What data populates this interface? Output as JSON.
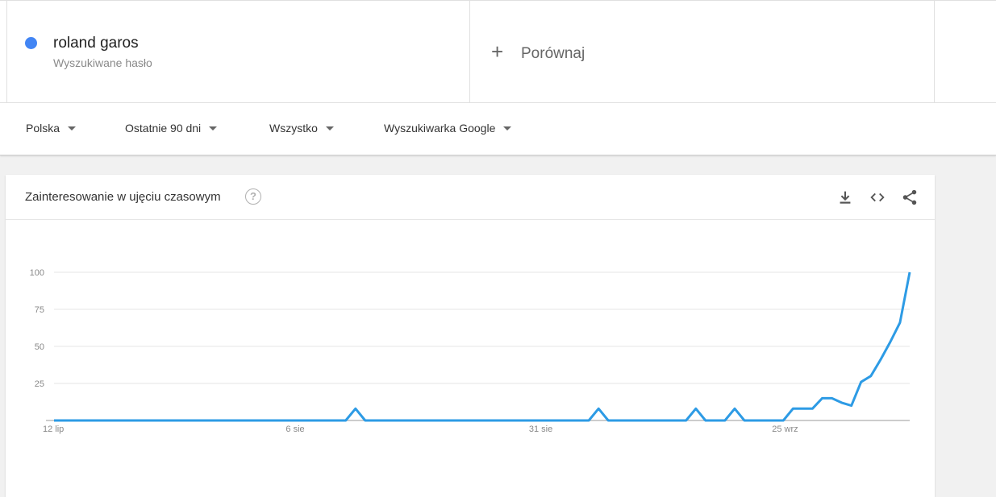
{
  "term": {
    "name": "roland garos",
    "subtitle": "Wyszukiwane hasło",
    "color": "#4285f4"
  },
  "compare": {
    "label": "Porównaj",
    "icon": "plus-icon"
  },
  "filters": [
    {
      "label": "Polska"
    },
    {
      "label": "Ostatnie 90 dni"
    },
    {
      "label": "Wszystko"
    },
    {
      "label": "Wyszukiwarka Google"
    }
  ],
  "card": {
    "title": "Zainteresowanie w ujęciu czasowym",
    "icons": [
      "help-icon",
      "download-icon",
      "embed-icon",
      "share-icon"
    ]
  },
  "chart_data": {
    "type": "line",
    "title": "Zainteresowanie w ujęciu czasowym",
    "xlabel": "",
    "ylabel": "",
    "ylim": [
      0,
      100
    ],
    "yticks": [
      25,
      50,
      75,
      100
    ],
    "grid": true,
    "line_color": "#2d9be5",
    "x_tick_labels": [
      {
        "label": "12 lip",
        "index": 0
      },
      {
        "label": "6 sie",
        "index": 25
      },
      {
        "label": "31 sie",
        "index": 50
      },
      {
        "label": "25 wrz",
        "index": 75
      }
    ],
    "values": [
      0,
      0,
      0,
      0,
      0,
      0,
      0,
      0,
      0,
      0,
      0,
      0,
      0,
      0,
      0,
      0,
      0,
      0,
      0,
      0,
      0,
      0,
      0,
      0,
      0,
      0,
      0,
      0,
      0,
      0,
      0,
      8,
      0,
      0,
      0,
      0,
      0,
      0,
      0,
      0,
      0,
      0,
      0,
      0,
      0,
      0,
      0,
      0,
      0,
      0,
      0,
      0,
      0,
      0,
      0,
      0,
      8,
      0,
      0,
      0,
      0,
      0,
      0,
      0,
      0,
      0,
      8,
      0,
      0,
      0,
      8,
      0,
      0,
      0,
      0,
      0,
      8,
      8,
      8,
      15,
      15,
      12,
      10,
      26,
      30,
      41,
      53,
      66,
      100
    ]
  }
}
